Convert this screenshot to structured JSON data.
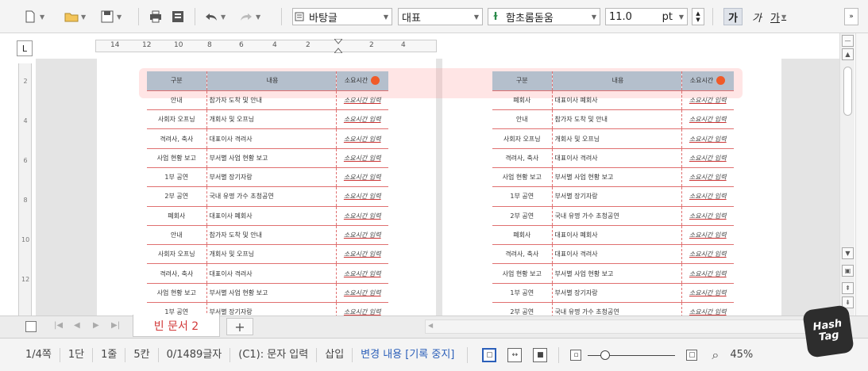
{
  "toolbar": {
    "style_combo": "바탕글",
    "outline_combo": "대표",
    "font_combo": "함초롬돋움",
    "font_size": "11.0",
    "font_unit": "pt",
    "bold_label": "가",
    "italic_label": "가",
    "underline_label": "가"
  },
  "ruler": {
    "corner_label": "L",
    "h_ticks": [
      "14",
      "12",
      "10",
      "8",
      "6",
      "4",
      "2",
      "2",
      "4"
    ],
    "v_ticks": [
      "2",
      "4",
      "6",
      "8",
      "10",
      "12"
    ]
  },
  "table1": {
    "headers": [
      "구분",
      "내용",
      "소요시간"
    ],
    "rows": [
      [
        "안내",
        "참가자 도착 및 안내",
        "소요시간 입력"
      ],
      [
        "사회자 오프닝",
        "개회사 및 오프닝",
        "소요시간 입력"
      ],
      [
        "격려사, 축사",
        "대표이사 격려사",
        "소요시간 입력"
      ],
      [
        "사업 현황 보고",
        "부서별 사업 현황 보고",
        "소요시간 입력"
      ],
      [
        "1부 공연",
        "부서별 장기자랑",
        "소요시간 입력"
      ],
      [
        "2부 공연",
        "국내 유명 가수 초청공연",
        "소요시간 입력"
      ],
      [
        "폐회사",
        "대표이사 폐회사",
        "소요시간 입력"
      ],
      [
        "안내",
        "참가자 도착 및 안내",
        "소요시간 입력"
      ],
      [
        "사회자 오프닝",
        "개회사 및 오프닝",
        "소요시간 입력"
      ],
      [
        "격려사, 축사",
        "대표이사 격려사",
        "소요시간 입력"
      ],
      [
        "사업 현황 보고",
        "부서별 사업 현황 보고",
        "소요시간 입력"
      ],
      [
        "1부 공연",
        "부서별 장기자랑",
        "소요시간 입력"
      ]
    ]
  },
  "table2": {
    "headers": [
      "구분",
      "내용",
      "소요시간"
    ],
    "rows": [
      [
        "폐회사",
        "대표이사 폐회사",
        "소요시간 입력"
      ],
      [
        "안내",
        "참가자 도착 및 안내",
        "소요시간 입력"
      ],
      [
        "사회자 오프닝",
        "개회사 및 오프닝",
        "소요시간 입력"
      ],
      [
        "격려사, 축사",
        "대표이사 격려사",
        "소요시간 입력"
      ],
      [
        "사업 현황 보고",
        "부서별 사업 현황 보고",
        "소요시간 입력"
      ],
      [
        "1부 공연",
        "부서별 장기자랑",
        "소요시간 입력"
      ],
      [
        "2부 공연",
        "국내 유명 가수 초청공연",
        "소요시간 입력"
      ],
      [
        "폐회사",
        "대표이사 폐회사",
        "소요시간 입력"
      ],
      [
        "격려사, 축사",
        "대표이사 격려사",
        "소요시간 입력"
      ],
      [
        "사업 현황 보고",
        "부서별 사업 현황 보고",
        "소요시간 입력"
      ],
      [
        "1부 공연",
        "부서별 장기자랑",
        "소요시간 입력"
      ],
      [
        "2부 공연",
        "국내 유명 가수 초청공연",
        "소요시간 입력"
      ]
    ]
  },
  "tabs": {
    "active_label": "빈 문서 2",
    "add_label": "+"
  },
  "status": {
    "page": "1/4쪽",
    "column": "1단",
    "line": "1줄",
    "cell": "5칸",
    "chars": "0/1489글자",
    "mode": "(C1): 문자 입력",
    "insert": "삽입",
    "track": "변경 내용 [기록 중지]",
    "zoom": "45%"
  },
  "badge": {
    "line1": "Hash",
    "line2": "Tag"
  },
  "colors": {
    "accent_red": "#d23a3a",
    "header_fill": "#b4bfcc",
    "table_border": "#e07070",
    "status_blue": "#2b5fb9"
  }
}
